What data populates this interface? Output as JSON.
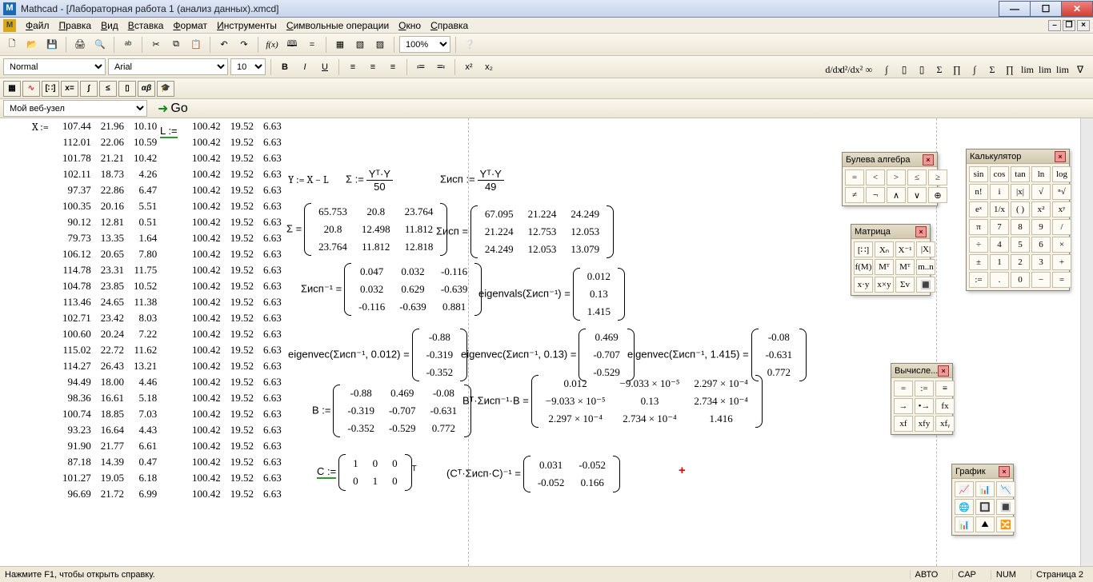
{
  "titlebar": {
    "app": "Mathcad",
    "doc": "[Лабораторная работа 1 (анализ данных).xmcd]"
  },
  "menu": [
    "Файл",
    "Правка",
    "Вид",
    "Вставка",
    "Формат",
    "Инструменты",
    "Символьные операции",
    "Окно",
    "Справка"
  ],
  "format_row": {
    "style": "Normal",
    "font": "Arial",
    "size": "10",
    "zoom": "100%"
  },
  "navbar": {
    "site": "Мой веб-узел",
    "go": "Go"
  },
  "status": {
    "hint": "Нажмите F1, чтобы открыть справку.",
    "auto": "АВТО",
    "cap": "CAP",
    "num": "NUM",
    "page": "Страница 2"
  },
  "matrices": {
    "X_label": "X :=",
    "L_label": "L :=",
    "X": [
      [
        107.44,
        21.96,
        10.1
      ],
      [
        112.01,
        22.06,
        10.59
      ],
      [
        101.78,
        21.21,
        10.42
      ],
      [
        102.11,
        18.73,
        4.26
      ],
      [
        97.37,
        22.86,
        6.47
      ],
      [
        100.35,
        20.16,
        5.51
      ],
      [
        90.12,
        12.81,
        0.51
      ],
      [
        79.73,
        13.35,
        1.64
      ],
      [
        106.12,
        20.65,
        7.8
      ],
      [
        114.78,
        23.31,
        11.75
      ],
      [
        104.78,
        23.85,
        10.52
      ],
      [
        113.46,
        24.65,
        11.38
      ],
      [
        102.71,
        23.42,
        8.03
      ],
      [
        100.6,
        20.24,
        7.22
      ],
      [
        115.02,
        22.72,
        11.62
      ],
      [
        114.27,
        26.43,
        13.21
      ],
      [
        94.49,
        18.0,
        4.46
      ],
      [
        98.36,
        16.61,
        5.18
      ],
      [
        100.74,
        18.85,
        7.03
      ],
      [
        93.23,
        16.64,
        4.43
      ],
      [
        91.9,
        21.77,
        6.61
      ],
      [
        87.18,
        14.39,
        0.47
      ],
      [
        101.27,
        19.05,
        6.18
      ],
      [
        96.69,
        21.72,
        6.99
      ]
    ],
    "L_row": [
      100.42,
      19.52,
      6.63
    ],
    "L_count": 24
  },
  "formulas": {
    "Y": "Y := X − L",
    "Sigma_def": "Σ :=",
    "Sigma_frac_top": "Yᵀ·Y",
    "Sigma_frac_bot": "50",
    "SigmaIsp_def": "Σисп :=",
    "SigmaIsp_frac_top": "Yᵀ·Y",
    "SigmaIsp_frac_bot": "49",
    "Sigma": [
      [
        65.753,
        20.8,
        23.764
      ],
      [
        20.8,
        12.498,
        11.812
      ],
      [
        23.764,
        11.812,
        12.818
      ]
    ],
    "SigmaIsp": [
      [
        67.095,
        21.224,
        24.249
      ],
      [
        21.224,
        12.753,
        12.053
      ],
      [
        24.249,
        12.053,
        13.079
      ]
    ],
    "SigmaIspInv": [
      [
        0.047,
        0.032,
        -0.116
      ],
      [
        0.032,
        0.629,
        -0.639
      ],
      [
        -0.116,
        -0.639,
        0.881
      ]
    ],
    "eigvals": [
      0.012,
      0.13,
      1.415
    ],
    "evec1": [
      -0.88,
      -0.319,
      -0.352
    ],
    "evec2": [
      0.469,
      -0.707,
      -0.529
    ],
    "evec3": [
      -0.08,
      -0.631,
      0.772
    ],
    "B": [
      [
        -0.88,
        0.469,
        -0.08
      ],
      [
        -0.319,
        -0.707,
        -0.631
      ],
      [
        -0.352,
        -0.529,
        0.772
      ]
    ],
    "BtSB_rows": [
      [
        "0.012",
        "−9.033 × 10⁻⁵",
        "2.297 × 10⁻⁴"
      ],
      [
        "−9.033 × 10⁻⁵",
        "0.13",
        "2.734 × 10⁻⁴"
      ],
      [
        "2.297 × 10⁻⁴",
        "2.734 × 10⁻⁴",
        "1.416"
      ]
    ],
    "C": [
      [
        1,
        0,
        0
      ],
      [
        0,
        1,
        0
      ]
    ],
    "CtSCinv": [
      [
        0.031,
        -0.052
      ],
      [
        -0.052,
        0.166
      ]
    ],
    "labels": {
      "Sigma_eq": "Σ =",
      "SigmaIsp_eq": "Σисп =",
      "SigmaIspInv_eq": "Σисп⁻¹ =",
      "eigvals": "eigenvals(Σисп⁻¹) =",
      "evec1": "eigenvec(Σисп⁻¹, 0.012) =",
      "evec2": "eigenvec(Σисп⁻¹, 0.13) =",
      "evec3": "eigenvec(Σисп⁻¹, 1.415) =",
      "B": "B :=",
      "BtSB": "Bᵀ·Σисп⁻¹·B =",
      "C": "C :=",
      "CT": "T",
      "CtSCinv": "(Cᵀ·Σисп·C)⁻¹ ="
    }
  },
  "palettes": {
    "boolean": {
      "title": "Булева алгебра",
      "cells": [
        "=",
        "<",
        ">",
        "≤",
        "≥",
        "≠",
        "¬",
        "∧",
        "∨",
        "⊕"
      ]
    },
    "matrix": {
      "title": "Матрица",
      "cells": [
        "[∷]",
        "Xₙ",
        "X⁻¹",
        "|X|",
        "f(M)",
        "Mᵀ",
        "Mᵀ",
        "m..n",
        "x·y",
        "x×y",
        "Σv",
        "🔳"
      ]
    },
    "calc": {
      "title": "Калькулятор",
      "cells": [
        "sin",
        "cos",
        "tan",
        "ln",
        "log",
        "n!",
        "i",
        "|x|",
        "√",
        "ⁿ√",
        "eˣ",
        "1/x",
        "( )",
        "x²",
        "xʸ",
        "π",
        "7",
        "8",
        "9",
        "/",
        "÷",
        "4",
        "5",
        "6",
        "×",
        "±",
        "1",
        "2",
        "3",
        "+",
        ":=",
        ".",
        "0",
        "−",
        "="
      ]
    },
    "eval": {
      "title": "Вычисле...",
      "cells": [
        "=",
        ":=",
        "≡",
        "→",
        "•→",
        "fx",
        "xf",
        "xfy",
        "xfᵧ"
      ]
    },
    "graph": {
      "title": "График",
      "cells": [
        "📈",
        "📊",
        "📉",
        "🌐",
        "🔲",
        "🔳",
        "📊",
        "⛰",
        "🔀"
      ]
    }
  },
  "rightbar": [
    "d/dx",
    "d²/dx²",
    "∞",
    "∫",
    "▯",
    "▯",
    "Σ",
    "∏",
    "∫",
    "Σ",
    "∏",
    "lim",
    "lim",
    "lim",
    "∇"
  ]
}
